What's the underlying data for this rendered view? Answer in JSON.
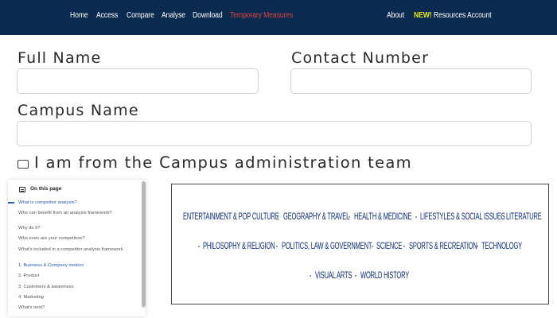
{
  "nav": {
    "left_items": [
      "Home",
      "Access",
      "Compare",
      "Analyse",
      "Download",
      "Temporary Measures"
    ],
    "right": {
      "about": "About",
      "new_tag": "NEW!",
      "resources": "Resources",
      "account": "Account"
    },
    "colors": {
      "bar": "#0a2a4f",
      "highlight": "#e0443c",
      "new_tag": "#e3e61a"
    }
  },
  "form": {
    "full_name_label": "Full Name",
    "contact_number_label": "Contact Number",
    "campus_name_label": "Campus Name",
    "full_name_value": "",
    "contact_number_value": "",
    "campus_name_value": "",
    "admin_checkbox_label": "I am from the Campus administration team",
    "admin_checkbox_checked": false
  },
  "toc": {
    "title": "On this page",
    "items": [
      "What is competitor analysis?",
      "Who can benefit from an analysis framework?",
      "Why do it?",
      "Who even are your competitors?",
      "What's included in a competitor analysis framework",
      "1. Business & Company metrics",
      "2. Product",
      "3. Customers & awareness",
      "4. Marketing",
      "What's next?"
    ],
    "active_index": 0
  },
  "categories": {
    "row1": [
      "ENTERTAINMENT & POP CULTURE",
      "GEOGRAPHY & TRAVEL",
      "HEALTH & MEDICINE",
      "LIFESTYLES & SOCIAL ISSUES",
      "LITERATURE"
    ],
    "row2": [
      "PHILOSOPHY & RELIGION",
      "POLITICS, LAW & GOVERNMENT",
      "SCIENCE",
      "SPORTS & RECREATION",
      "TECHNOLOGY"
    ],
    "row3": [
      "VISUAL ARTS",
      "WORLD HISTORY"
    ],
    "color": "#0c2a78"
  }
}
